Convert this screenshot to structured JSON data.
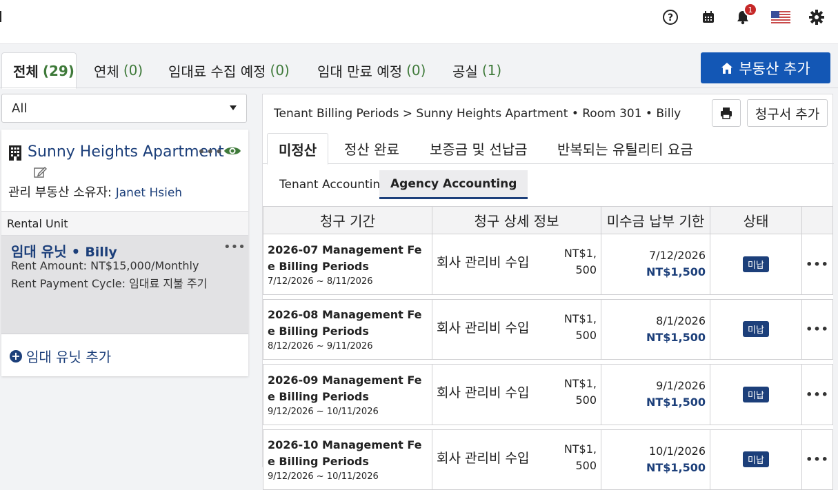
{
  "header": {
    "icons": [
      "help-icon",
      "calendar-icon",
      "bell-icon",
      "us-flag-icon",
      "gear-icon"
    ],
    "notification_count": "1"
  },
  "status_tabs": [
    {
      "label": "전체",
      "count": "(29)"
    },
    {
      "label": "연체",
      "count": "(0)"
    },
    {
      "label": "임대료 수집 예정",
      "count": "(0)"
    },
    {
      "label": "임대 만료 예정",
      "count": "(0)"
    },
    {
      "label": "공실",
      "count": "(1)"
    }
  ],
  "add_property_label": "부동산 추가",
  "filter": {
    "selected": "All"
  },
  "property": {
    "name": "Sunny Heights Apartment",
    "owner_label": "관리 부동산 소유자:",
    "owner_name": "Janet Hsieh",
    "rental_unit_header": "Rental Unit",
    "unit": {
      "name": "임대 유닛",
      "separator": "•",
      "tenant": "Billy",
      "rent_amount": "Rent Amount: NT$15,000/Monthly",
      "payment_cycle": "Rent Payment Cycle: 임대료 지불 주기"
    },
    "add_unit_label": "임대 유닛 추가"
  },
  "breadcrumb": "Tenant Billing Periods >  Sunny Heights Apartment • Room 301 • Billy",
  "invoice_button": "청구서 추가",
  "billing_tabs": [
    "미정산",
    "정산 완료",
    "보증금 및 선납금",
    "반복되는 유틸리티 요금"
  ],
  "accounting_tabs": [
    "Tenant Accounting",
    "Agency Accounting"
  ],
  "table": {
    "headers": [
      "청구 기간",
      "청구 상세 정보",
      "미수금 납부 기한",
      "상태",
      ""
    ],
    "rows": [
      {
        "title": "2026-07 Management Fee Billing Periods",
        "range": "7/12/2026 ~ 8/11/2026",
        "detail": "회사 관리비 수입",
        "amount": "NT$1,500",
        "due_date": "7/12/2026",
        "balance": "NT$1,500",
        "status": "미납"
      },
      {
        "title": "2026-08 Management Fee Billing Periods",
        "range": "8/12/2026 ~ 9/11/2026",
        "detail": "회사 관리비 수입",
        "amount": "NT$1,500",
        "due_date": "8/1/2026",
        "balance": "NT$1,500",
        "status": "미납"
      },
      {
        "title": "2026-09 Management Fee Billing Periods",
        "range": "9/12/2026 ~ 10/11/2026",
        "detail": "회사 관리비 수입",
        "amount": "NT$1,500",
        "due_date": "9/1/2026",
        "balance": "NT$1,500",
        "status": "미납"
      },
      {
        "title": "2026-10 Management Fee Billing Periods",
        "range": "9/12/2026 ~ 10/11/2026",
        "detail": "회사 관리비 수입",
        "amount": "NT$1,500",
        "due_date": "10/1/2026",
        "balance": "NT$1,500",
        "status": "미납"
      }
    ]
  },
  "colors": {
    "accent": "#1357b5",
    "link": "#1c3f7a",
    "count_green": "#3f7a3a",
    "badge_red": "#c62828"
  }
}
